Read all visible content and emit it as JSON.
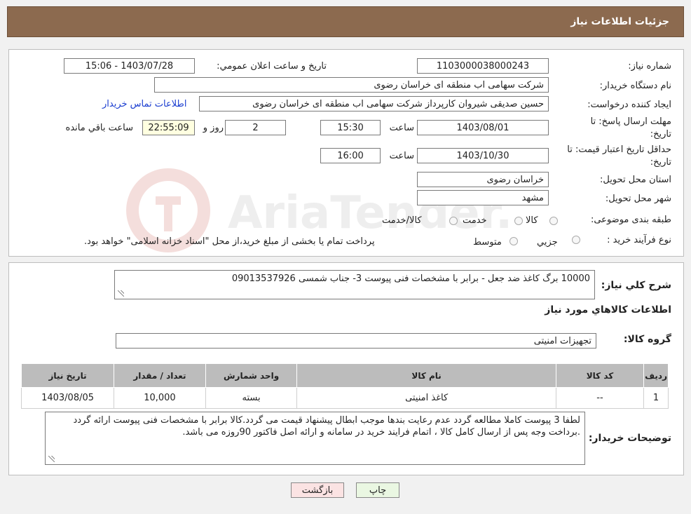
{
  "window": {
    "title": "جزئيات اطلاعات نياز"
  },
  "form": {
    "need_number_label": "شماره نياز:",
    "need_number": "1103000038000243",
    "announce_label": "تاريخ و ساعت اعلان عمومي:",
    "announce_value": "1403/07/28 - 15:06",
    "buyer_org_label": "نام دستگاه خريدار:",
    "buyer_org": "شرکت سهامی اب منطقه ای خراسان رضوی",
    "requester_label": "ايجاد کننده درخواست:",
    "requester": "حسین صدیقی شیروان کارپرداز شرکت سهامی اب منطقه ای خراسان رضوی",
    "contact_link": "اطلاعات تماس خريدار",
    "deadline_label": "مهلت ارسال پاسخ: تا تاريخ:",
    "deadline_date": "1403/08/01",
    "time_word": "ساعت",
    "deadline_time": "15:30",
    "days_value": "2",
    "days_word": "روز و",
    "remaining_time": "22:55:09",
    "remaining_word": "ساعت باقي مانده",
    "validity_label": "حداقل تاريخ اعتبار قيمت: تا تاريخ:",
    "validity_date": "1403/10/30",
    "validity_time": "16:00",
    "province_label": "استان محل تحويل:",
    "province": "خراسان رضوی",
    "city_label": "شهر محل تحويل:",
    "city": "مشهد",
    "category_label": "طبقه بندی موضوعی:",
    "category_options": [
      "کالا",
      "خدمت",
      "کالا/خدمت"
    ],
    "process_label": "نوع فرآيند خريد :",
    "process_options": [
      "جزيي",
      "متوسط"
    ],
    "process_note": "پرداخت تمام يا بخشی از مبلغ خريد،از محل \"اسناد خزانه اسلامی\" خواهد بود."
  },
  "details": {
    "summary_label": "شرح کلي نياز:",
    "summary": "10000 برگ کاغذ ضد جعل - برابر با مشخصات فنی پیوست 3- جناب شمسی 09013537926",
    "goods_heading": "اطلاعات کالاهاي مورد نياز",
    "group_label": "گروه کالا:",
    "group_value": "تجهیزات امنیتی",
    "table": {
      "headers": [
        "رديف",
        "کد کالا",
        "نام کالا",
        "واحد شمارش",
        "تعداد / مقدار",
        "تاريخ نياز"
      ],
      "rows": [
        [
          "1",
          "--",
          "کاغذ امنیتی",
          "بسته",
          "10,000",
          "1403/08/05"
        ]
      ]
    },
    "buyer_notes_label": "توضيحات خريدار:",
    "buyer_notes": "لطفا 3 پیوست کاملا مطالعه گردد عدم رعایت بندها موجب ابطال پیشنهاد قیمت می گردد.کالا برابر با مشخصات فنی پیوست ارائه گردد .برداخت وجه پس از ارسال کامل کالا ، اتمام فرایند خرید در سامانه و ارائه اصل فاکتور 90روزه می باشد."
  },
  "buttons": {
    "print": "چاپ",
    "back": "بازگشت"
  },
  "colors": {
    "title_bar": "#8c6a4f",
    "back_button": "#fbe3e3",
    "print_button": "#eaf7e2"
  }
}
